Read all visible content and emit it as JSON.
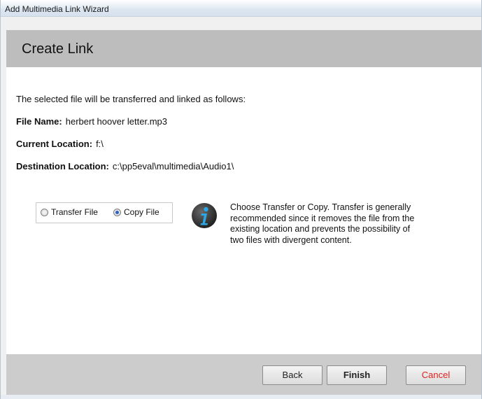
{
  "window": {
    "title": "Add Multimedia Link Wizard"
  },
  "header": {
    "title": "Create Link"
  },
  "content": {
    "intro": "The selected file will be transferred and linked as follows:",
    "file_name_label": "File Name:",
    "file_name_value": "herbert hoover letter.mp3",
    "current_location_label": "Current Location:",
    "current_location_value": "f:\\",
    "destination_location_label": "Destination Location:",
    "destination_location_value": "c:\\pp5eval\\multimedia\\Audio1\\"
  },
  "options": {
    "transfer_label": "Transfer File",
    "copy_label": "Copy File",
    "selected": "Copy File"
  },
  "info": {
    "icon": "info-icon",
    "lines": [
      "Choose Transfer or Copy.  Transfer is generally",
      "recommended since it removes the file from the",
      "existing location and prevents the possibility of",
      "two files with divergent content."
    ]
  },
  "buttons": {
    "back": "Back",
    "finish": "Finish",
    "cancel": "Cancel"
  },
  "colors": {
    "cancel_text": "#e02020",
    "header_band": "#bdbdbd",
    "footer_band": "#cccccc",
    "radio_selected": "#2f63c0"
  }
}
